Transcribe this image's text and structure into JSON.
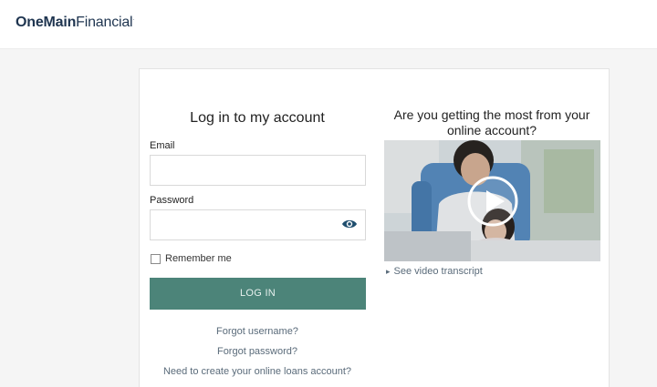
{
  "header": {
    "logo_bold": "OneMain",
    "logo_light": "Financial",
    "logo_mark": "."
  },
  "login": {
    "title": "Log in to my account",
    "email_label": "Email",
    "email_value": "",
    "password_label": "Password",
    "password_value": "",
    "remember_label": "Remember me",
    "remember_checked": false,
    "login_button": "LOG IN",
    "forgot_username": "Forgot username?",
    "forgot_password": "Forgot password?",
    "create_account": "Need to create your online loans account?"
  },
  "promo": {
    "title": "Are you getting the most from your online account?",
    "transcript_link": "See video transcript",
    "video_icon": "play-icon"
  },
  "colors": {
    "brand_navy": "#1f3550",
    "button_green": "#4c8479",
    "eye_icon": "#1f4e6e",
    "link_gray": "#5a6b7a"
  }
}
